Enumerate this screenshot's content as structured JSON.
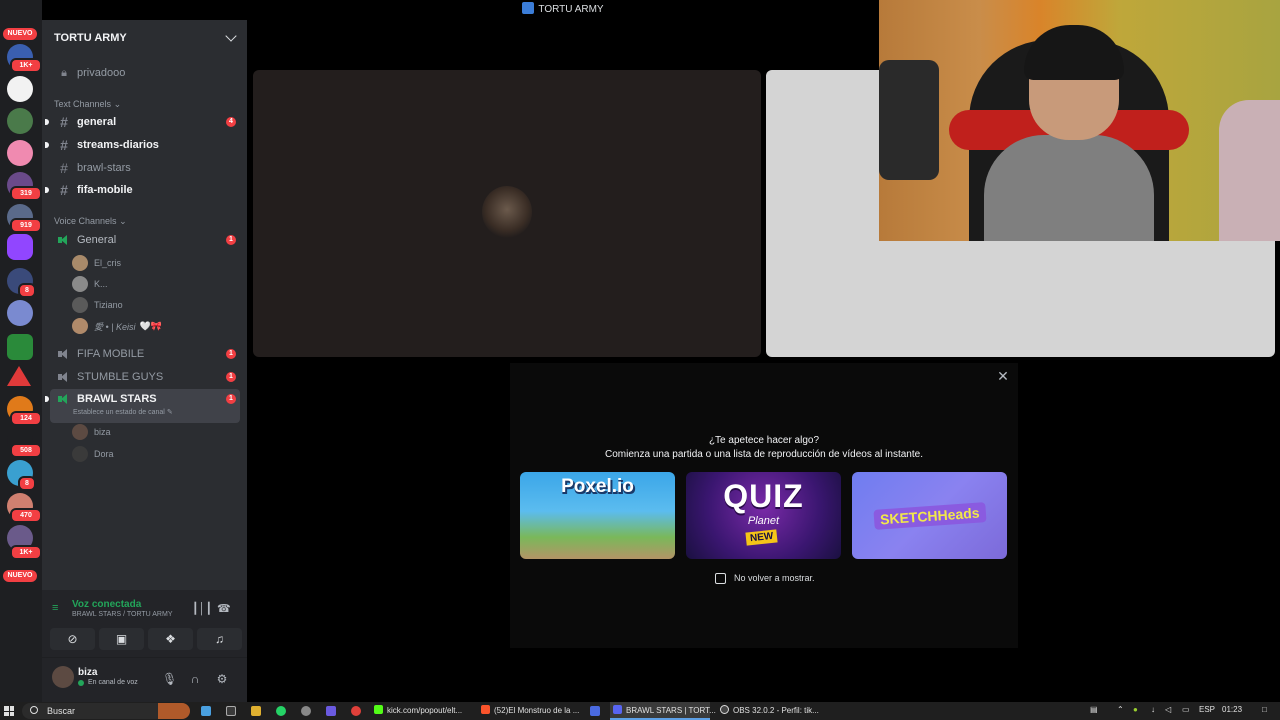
{
  "window": {
    "title": "TORTU ARMY"
  },
  "rail": {
    "badges": [
      "NUEVO",
      "1K+",
      "319",
      "919",
      "8",
      "124",
      "508",
      "8",
      "470",
      "1K+",
      "NUEVO"
    ]
  },
  "server": {
    "name": "TORTU ARMY"
  },
  "channels": {
    "private": "privadooo",
    "text_category": "Text Channels",
    "text": [
      {
        "name": "general",
        "mentions": "4",
        "unread": true
      },
      {
        "name": "streams-diarios",
        "mentions": "",
        "unread": true
      },
      {
        "name": "brawl-stars",
        "mentions": "",
        "unread": false
      },
      {
        "name": "fifa-mobile",
        "mentions": "",
        "unread": true
      }
    ],
    "voice_category": "Voice Channels",
    "voice": [
      {
        "name": "General",
        "mentions": "1"
      },
      {
        "name": "FIFA MOBILE",
        "mentions": "1"
      },
      {
        "name": "STUMBLE GUYS",
        "mentions": "1"
      },
      {
        "name": "BRAWL STARS",
        "mentions": "1"
      }
    ],
    "general_users": [
      "El_cris",
      "K...",
      "Tiziano",
      "愛 • | Keisi"
    ],
    "general_user_extra": "🤍🎀",
    "brawl_status": "Establece un estado de canal",
    "brawl_users": [
      "biza",
      "Dora"
    ]
  },
  "voice_panel": {
    "status": "Voz conectada",
    "path": "BRAWL STARS / TORTU ARMY"
  },
  "user": {
    "name": "biza",
    "status": "En canal de voz"
  },
  "modal": {
    "question": "¿Te apetece hacer algo?",
    "subtitle": "Comienza una partida o una lista de reproducción de vídeos al instante.",
    "activities": [
      {
        "name": "Poxel.io"
      },
      {
        "name": "QUIZ",
        "sub": "Planet",
        "tag": "NEW"
      },
      {
        "name": "SKETCHHeads"
      }
    ],
    "checkbox_label": "No volver a mostrar."
  },
  "taskbar": {
    "search_placeholder": "Buscar",
    "items": [
      "kick.com/popout/elt...",
      "(52)El Monstruo de la ...",
      "BRAWL STARS | TORT...",
      "OBS 32.0.2 - Perfil: tik..."
    ],
    "lang": "ESP",
    "time": "01:23"
  },
  "colors": {
    "accent_green": "#23a55a",
    "mention_red": "#f23f43",
    "sidebar_bg": "#2b2d31",
    "rail_bg": "#1e1f22"
  }
}
